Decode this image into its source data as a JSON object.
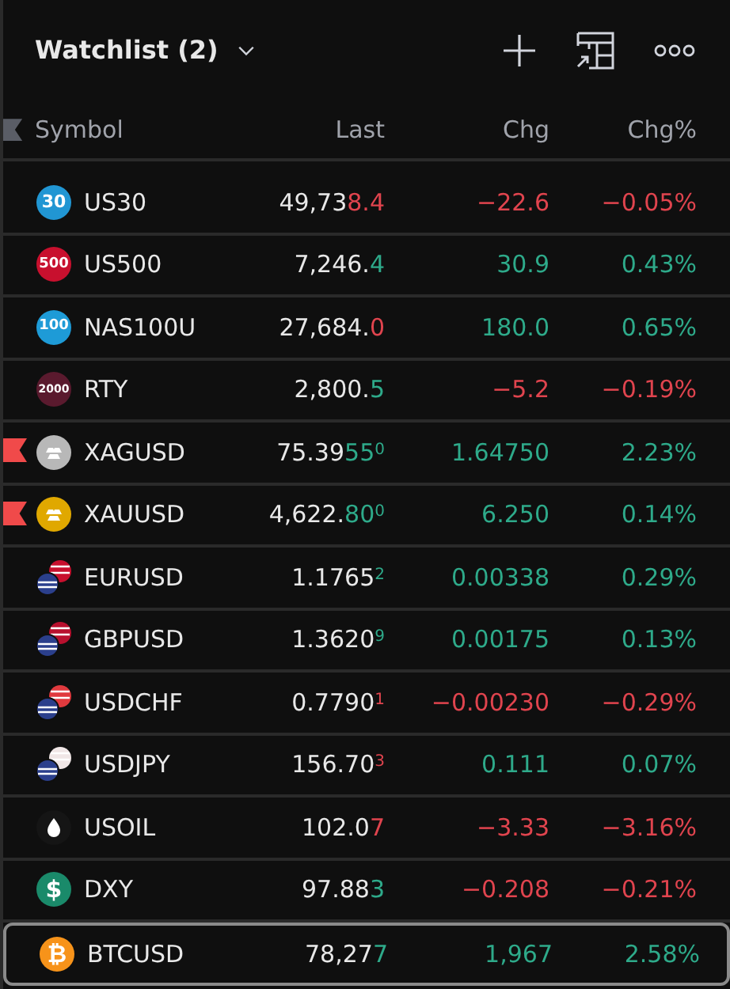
{
  "header": {
    "title": "Watchlist (2)"
  },
  "columns": [
    "Symbol",
    "Last",
    "Chg",
    "Chg%"
  ],
  "rows": [
    {
      "symbol": "US30",
      "icon": {
        "kind": "badge",
        "text": "30",
        "color": "#2196d3"
      },
      "flagged": false,
      "selected": false,
      "last": {
        "base": "49,73",
        "tick": "8.4",
        "rising": false
      },
      "change": "−22.6",
      "change_pct": "−0.05%",
      "rising": false
    },
    {
      "symbol": "US500",
      "icon": {
        "kind": "badge",
        "text": "500",
        "color": "#c8102e"
      },
      "flagged": false,
      "selected": false,
      "last": {
        "base": "7,246.",
        "tick": "4",
        "rising": true
      },
      "change": "30.9",
      "change_pct": "0.43%",
      "rising": true
    },
    {
      "symbol": "NAS100U",
      "icon": {
        "kind": "badge",
        "text": "100",
        "color": "#1e9bd7"
      },
      "flagged": false,
      "selected": false,
      "last": {
        "base": "27,684.",
        "tick": "0",
        "rising": false
      },
      "change": "180.0",
      "change_pct": "0.65%",
      "rising": true
    },
    {
      "symbol": "RTY",
      "icon": {
        "kind": "badge",
        "text": "2000",
        "color": "#5a1a2e"
      },
      "flagged": false,
      "selected": false,
      "last": {
        "base": "2,800.",
        "tick": "5",
        "rising": true
      },
      "change": "−5.2",
      "change_pct": "−0.19%",
      "rising": false
    },
    {
      "symbol": "XAGUSD",
      "icon": {
        "kind": "metal",
        "color": "#b8b8b8"
      },
      "flagged": true,
      "selected": false,
      "last": {
        "base": "75.39",
        "tick": "55",
        "pip": "0",
        "rising": true
      },
      "change": "1.64750",
      "change_pct": "2.23%",
      "rising": true
    },
    {
      "symbol": "XAUUSD",
      "icon": {
        "kind": "metal",
        "color": "#e0a800"
      },
      "flagged": true,
      "selected": false,
      "last": {
        "base": "4,622.",
        "tick": "80",
        "pip": "0",
        "rising": true
      },
      "change": "6.250",
      "change_pct": "0.14%",
      "rising": true
    },
    {
      "symbol": "EURUSD",
      "icon": {
        "kind": "pair",
        "color": "#c8102e"
      },
      "flagged": false,
      "selected": false,
      "last": {
        "base": "1.1765",
        "pip": "2",
        "rising": true
      },
      "change": "0.00338",
      "change_pct": "0.29%",
      "rising": true
    },
    {
      "symbol": "GBPUSD",
      "icon": {
        "kind": "pair",
        "color": "#b8102e"
      },
      "flagged": false,
      "selected": false,
      "last": {
        "base": "1.3620",
        "pip": "9",
        "rising": true
      },
      "change": "0.00175",
      "change_pct": "0.13%",
      "rising": true
    },
    {
      "symbol": "USDCHF",
      "icon": {
        "kind": "pair",
        "color": "#e03a3e"
      },
      "flagged": false,
      "selected": false,
      "last": {
        "base": "0.7790",
        "pip": "1",
        "rising": false
      },
      "change": "−0.00230",
      "change_pct": "−0.29%",
      "rising": false
    },
    {
      "symbol": "USDJPY",
      "icon": {
        "kind": "pair",
        "color": "#f0e6e6"
      },
      "flagged": false,
      "selected": false,
      "last": {
        "base": "156.70",
        "pip": "3",
        "rising": false
      },
      "change": "0.111",
      "change_pct": "0.07%",
      "rising": true
    },
    {
      "symbol": "USOIL",
      "icon": {
        "kind": "drop",
        "color": "#ffffff"
      },
      "flagged": false,
      "selected": false,
      "last": {
        "base": "102.0",
        "tick": "7",
        "rising": false
      },
      "change": "−3.33",
      "change_pct": "−3.16%",
      "rising": false
    },
    {
      "symbol": "DXY",
      "icon": {
        "kind": "badge",
        "text": "$",
        "color": "#1a8a6a"
      },
      "flagged": false,
      "selected": false,
      "last": {
        "base": "97.88",
        "tick": "3",
        "rising": true
      },
      "change": "−0.208",
      "change_pct": "−0.21%",
      "rising": false
    },
    {
      "symbol": "BTCUSD",
      "icon": {
        "kind": "badge",
        "text": "₿",
        "color": "#f7931a"
      },
      "flagged": false,
      "selected": true,
      "last": {
        "base": "78,27",
        "tick": "7",
        "rising": true
      },
      "change": "1,967",
      "change_pct": "2.58%",
      "rising": true
    }
  ]
}
